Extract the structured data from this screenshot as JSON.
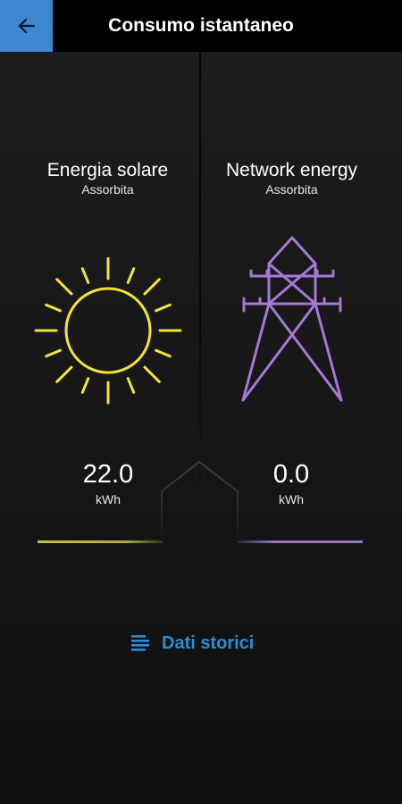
{
  "header": {
    "title": "Consumo istantaneo"
  },
  "solar": {
    "title": "Energia solare",
    "subtitle": "Assorbita",
    "value": "22.0",
    "unit": "kWh",
    "color": "#f2e437",
    "icon": "sun-icon"
  },
  "network": {
    "title": "Network energy",
    "subtitle": "Assorbita",
    "value": "0.0",
    "unit": "kWh",
    "color": "#a678d6",
    "icon": "power-pylon-icon"
  },
  "history_button": {
    "label": "Dati storici",
    "icon": "list-icon",
    "color": "#2a8fd6"
  },
  "colors": {
    "back_button": "#3f86d0",
    "background": "#1a1a1a"
  }
}
